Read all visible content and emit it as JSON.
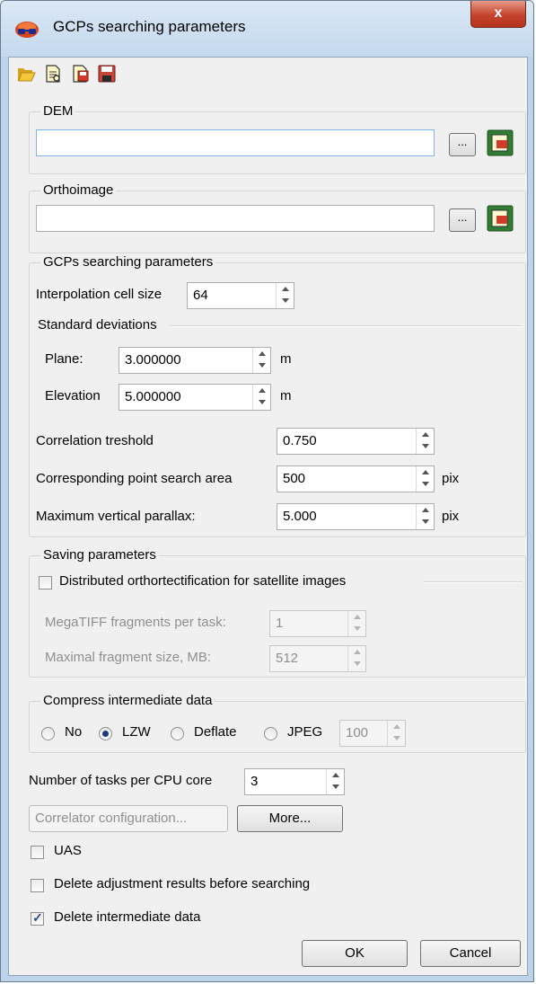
{
  "window": {
    "title": "GCPs searching parameters",
    "close_label": "x"
  },
  "toolbar": {
    "icons": [
      "open-folder-icon",
      "open-file-icon",
      "save-as-icon",
      "save-icon"
    ]
  },
  "dem": {
    "legend": "DEM",
    "value": "",
    "browse_label": "..."
  },
  "ortho": {
    "legend": "Orthoimage",
    "value": "",
    "browse_label": "..."
  },
  "gcp": {
    "legend": "GCPs searching parameters",
    "interp_label": "Interpolation cell size",
    "interp_value": "64",
    "std_dev_label": "Standard deviations",
    "plane_label": "Plane:",
    "plane_value": "3.000000",
    "plane_unit": "m",
    "elev_label": "Elevation",
    "elev_value": "5.000000",
    "elev_unit": "m",
    "corr_label": "Correlation treshold",
    "corr_value": "0.750",
    "area_label": "Corresponding point search area",
    "area_value": "500",
    "area_unit": "pix",
    "parallax_label": "Maximum vertical parallax:",
    "parallax_value": "5.000",
    "parallax_unit": "pix"
  },
  "saving": {
    "legend": "Saving parameters",
    "distributed_label": "Distributed orthortectification for satellite images",
    "distributed_checked": false,
    "fragments_label": "MegaTIFF fragments per task:",
    "fragments_value": "1",
    "maxsize_label": "Maximal fragment size, MB:",
    "maxsize_value": "512"
  },
  "compress": {
    "legend": "Compress intermediate data",
    "options": [
      "No",
      "LZW",
      "Deflate",
      "JPEG"
    ],
    "selected": "LZW",
    "jpeg_quality": "100"
  },
  "tasks": {
    "label": "Number of tasks per CPU core",
    "value": "3"
  },
  "buttons": {
    "correlator": "Correlator configuration...",
    "more": "More...",
    "ok": "OK",
    "cancel": "Cancel"
  },
  "checks": {
    "uas": "UAS",
    "uas_checked": false,
    "delete_adjust": "Delete adjustment results before searching",
    "delete_adjust_checked": false,
    "delete_intermediate": "Delete intermediate data",
    "delete_intermediate_checked": true
  },
  "colors": {
    "title_bar": "#c4d8ee",
    "close_button": "#c5432c",
    "field_border_focus": "#7eb4ea",
    "dialog_bg": "#f0f0f0"
  }
}
